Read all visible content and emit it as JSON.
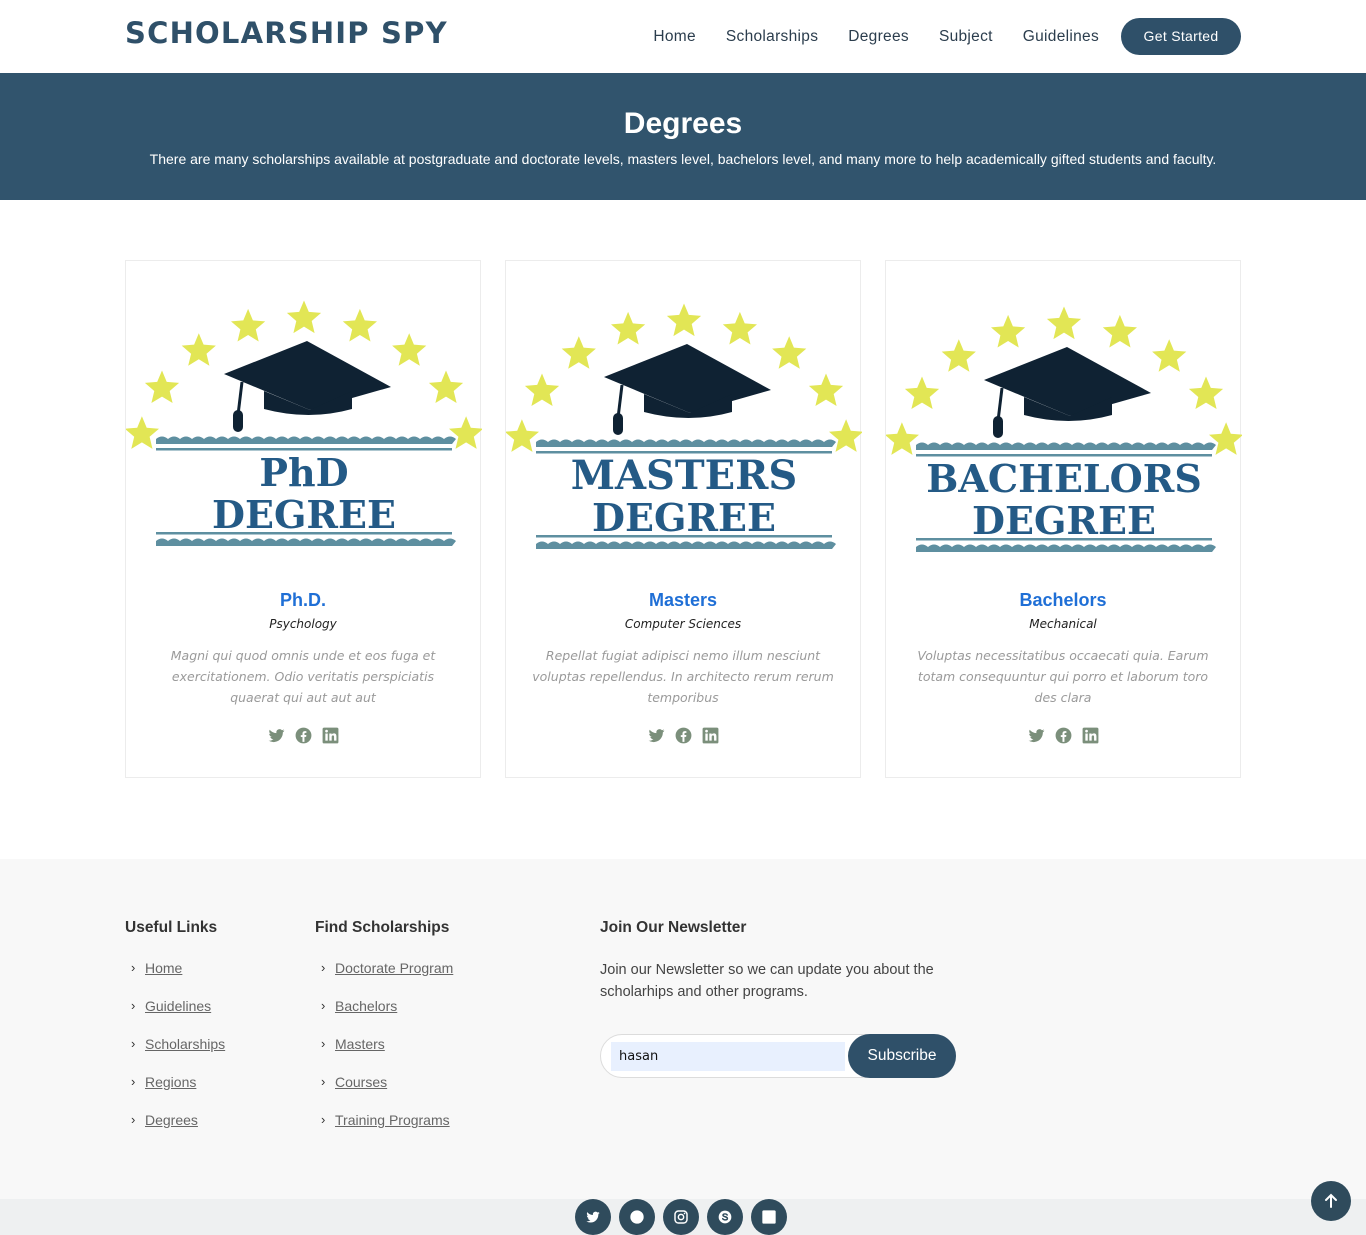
{
  "header": {
    "logo": "SCHOLARSHIP SPY",
    "nav": [
      "Home",
      "Scholarships",
      "Degrees",
      "Subject",
      "Guidelines"
    ],
    "cta": "Get Started"
  },
  "hero": {
    "title": "Degrees",
    "subtitle": "There are many scholarships available at postgraduate and doctorate levels, masters level, bachelors level, and many more to help academically gifted students and faculty."
  },
  "cards": [
    {
      "art_line1": "PhD",
      "art_line2": "DEGREE",
      "name": "Ph.D.",
      "subject": "Psychology",
      "desc": "Magni qui quod omnis unde et eos fuga et exercitationem. Odio veritatis perspiciatis quaerat qui aut aut aut"
    },
    {
      "art_line1": "MASTERS",
      "art_line2": "DEGREE",
      "name": "Masters",
      "subject": "Computer Sciences",
      "desc": "Repellat fugiat adipisci nemo illum nesciunt voluptas repellendus. In architecto rerum rerum temporibus"
    },
    {
      "art_line1": "BACHELORS",
      "art_line2": "DEGREE",
      "name": "Bachelors",
      "subject": "Mechanical",
      "desc": "Voluptas necessitatibus occaecati quia. Earum totam consequuntur qui porro et laborum toro des clara"
    }
  ],
  "card_social_icons": [
    "twitter-icon",
    "facebook-icon",
    "linkedin-icon"
  ],
  "footer": {
    "useful_links": {
      "title": "Useful Links",
      "items": [
        "Home",
        "Guidelines",
        "Scholarships",
        "Regions",
        "Degrees"
      ]
    },
    "find": {
      "title": "Find Scholarships",
      "items": [
        "Doctorate Program",
        "Bachelors",
        "Masters",
        "Courses",
        "Training Programs"
      ]
    },
    "newsletter": {
      "title": "Join Our Newsletter",
      "text": "Join our Newsletter so we can update you about the scholarhips and other programs.",
      "input_value": "hasan",
      "button": "Subscribe"
    }
  },
  "bottom_social_icons": [
    "twitter-icon",
    "facebook-icon",
    "instagram-icon",
    "skype-icon",
    "linkedin-icon"
  ],
  "colors": {
    "primary": "#2f5069",
    "hero": "#31546d",
    "accent_blue": "#1f6fd6",
    "star": "#e2e655",
    "cap": "#0f2233",
    "art_text": "#245a86",
    "wave": "#5e8fa0"
  }
}
